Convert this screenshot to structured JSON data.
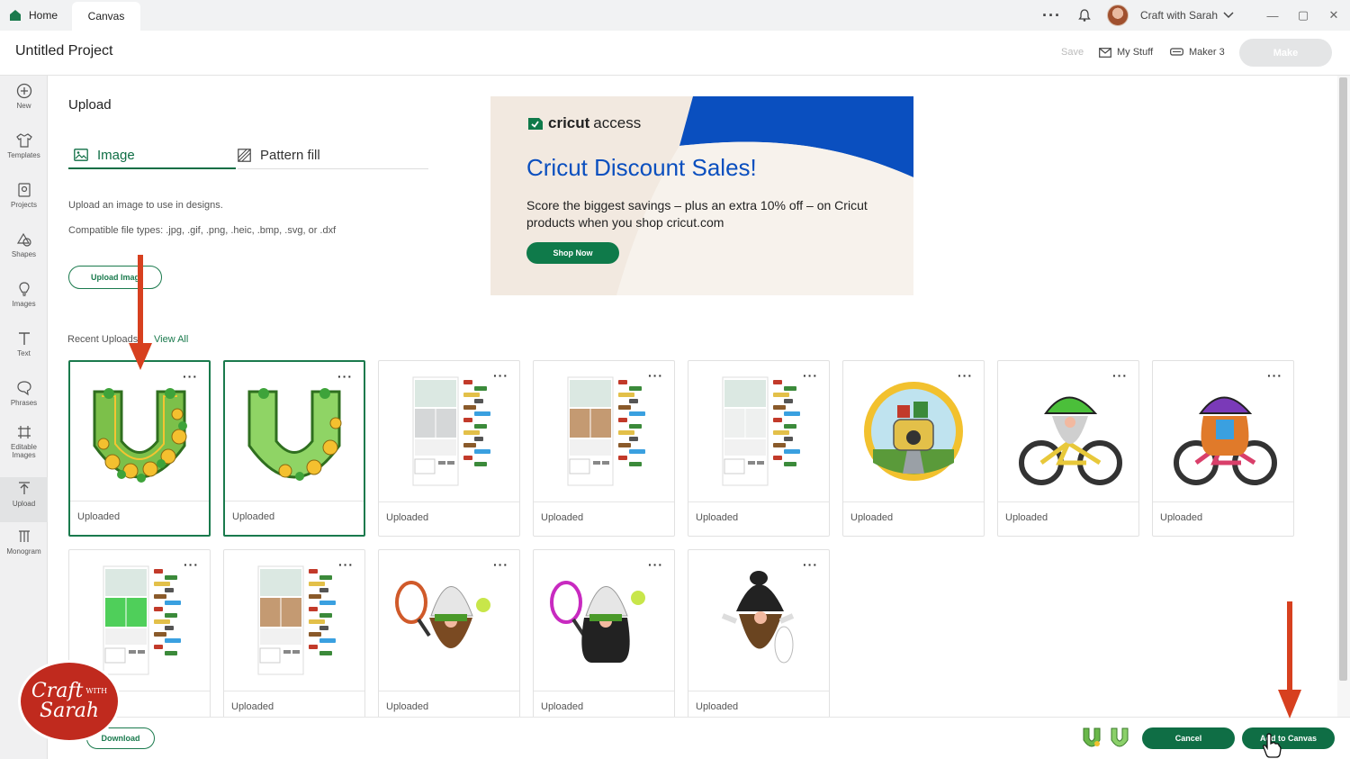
{
  "titlebar": {
    "tabs": [
      {
        "label": "Home"
      },
      {
        "label": "Canvas"
      }
    ],
    "user_name": "Craft with Sarah"
  },
  "header": {
    "project_title": "Untitled Project",
    "save_label": "Save",
    "mystuff_label": "My Stuff",
    "machine_label": "Maker 3",
    "make_label": "Make"
  },
  "sidebar": {
    "items": [
      {
        "label": "New",
        "icon": "plus-circle-icon"
      },
      {
        "label": "Templates",
        "icon": "shirt-icon"
      },
      {
        "label": "Projects",
        "icon": "projects-icon"
      },
      {
        "label": "Shapes",
        "icon": "shapes-icon"
      },
      {
        "label": "Images",
        "icon": "lightbulb-icon"
      },
      {
        "label": "Text",
        "icon": "text-icon"
      },
      {
        "label": "Phrases",
        "icon": "speech-bubble-icon"
      },
      {
        "label": "Editable Images",
        "icon": "editable-icon"
      },
      {
        "label": "Upload",
        "icon": "upload-icon"
      },
      {
        "label": "Monogram",
        "icon": "monogram-icon"
      }
    ]
  },
  "upload": {
    "heading": "Upload",
    "tab_image": "Image",
    "tab_pattern": "Pattern fill",
    "desc1": "Upload an image to use in designs.",
    "desc2": "Compatible file types: .jpg, .gif, .png, .heic, .bmp, .svg, or .dxf",
    "upload_button": "Upload Imag",
    "recent_label": "Recent Uploads",
    "view_all": "View All"
  },
  "ad": {
    "brand_bold": "cricut",
    "brand_light": "access",
    "headline": "Cricut Discount Sales!",
    "subtext": "Score the biggest savings – plus an extra 10% off – on Cricut products when you shop cricut.com",
    "button": "Shop Now",
    "colors": {
      "bg": "#f2e9e0",
      "blue": "#0a4fbf",
      "green": "#0f7a4a"
    }
  },
  "uploads": {
    "card_label": "Uploaded",
    "items": [
      {
        "kind": "horseshoe-flowers",
        "selected": true
      },
      {
        "kind": "horseshoe-plain",
        "selected": true
      },
      {
        "kind": "sheet-gray",
        "selected": false
      },
      {
        "kind": "sheet-tan",
        "selected": false
      },
      {
        "kind": "sheet-light",
        "selected": false
      },
      {
        "kind": "car-circle",
        "selected": false
      },
      {
        "kind": "gnome-bike-green",
        "selected": false
      },
      {
        "kind": "gnome-bike-purple",
        "selected": false
      },
      {
        "kind": "sheet-green",
        "selected": false
      },
      {
        "kind": "sheet-tan",
        "selected": false
      },
      {
        "kind": "gnome-tennis-orange",
        "selected": false
      },
      {
        "kind": "gnome-tennis-pink",
        "selected": false
      },
      {
        "kind": "gnome-black",
        "selected": false
      }
    ]
  },
  "footer": {
    "download_label": "Download",
    "cancel_label": "Cancel",
    "add_label": "Add to Canvas"
  },
  "watermark": {
    "line1": "Craft",
    "line2": "Sarah",
    "small": "WITH"
  }
}
